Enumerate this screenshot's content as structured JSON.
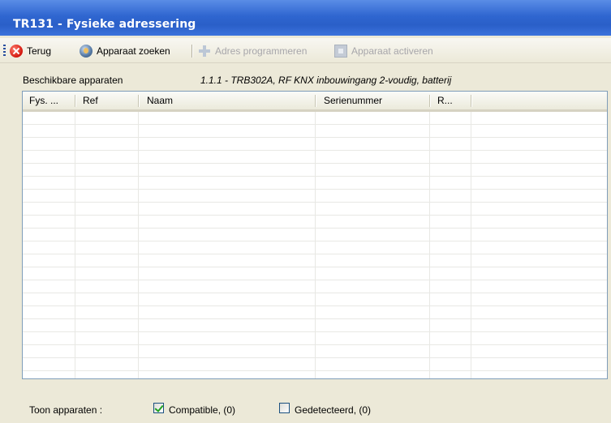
{
  "window": {
    "title": "TR131 - Fysieke adressering"
  },
  "toolbar": {
    "back_label": "Terug",
    "search_label": "Apparaat zoeken",
    "program_label": "Adres programmeren",
    "activate_label": "Apparaat activeren"
  },
  "available": {
    "label": "Beschikbare apparaten",
    "selected_device": "1.1.1 - TRB302A, RF KNX inbouwingang 2-voudig, batterij"
  },
  "table": {
    "columns": [
      "Fys. ...",
      "Ref",
      "Naam",
      "Serienummer",
      "R..."
    ],
    "rows": []
  },
  "footer": {
    "label": "Toon apparaten :",
    "compatible": {
      "label": "Compatible, (0)",
      "checked": true
    },
    "detected": {
      "label": "Gedetecteerd, (0)",
      "checked": false
    }
  }
}
